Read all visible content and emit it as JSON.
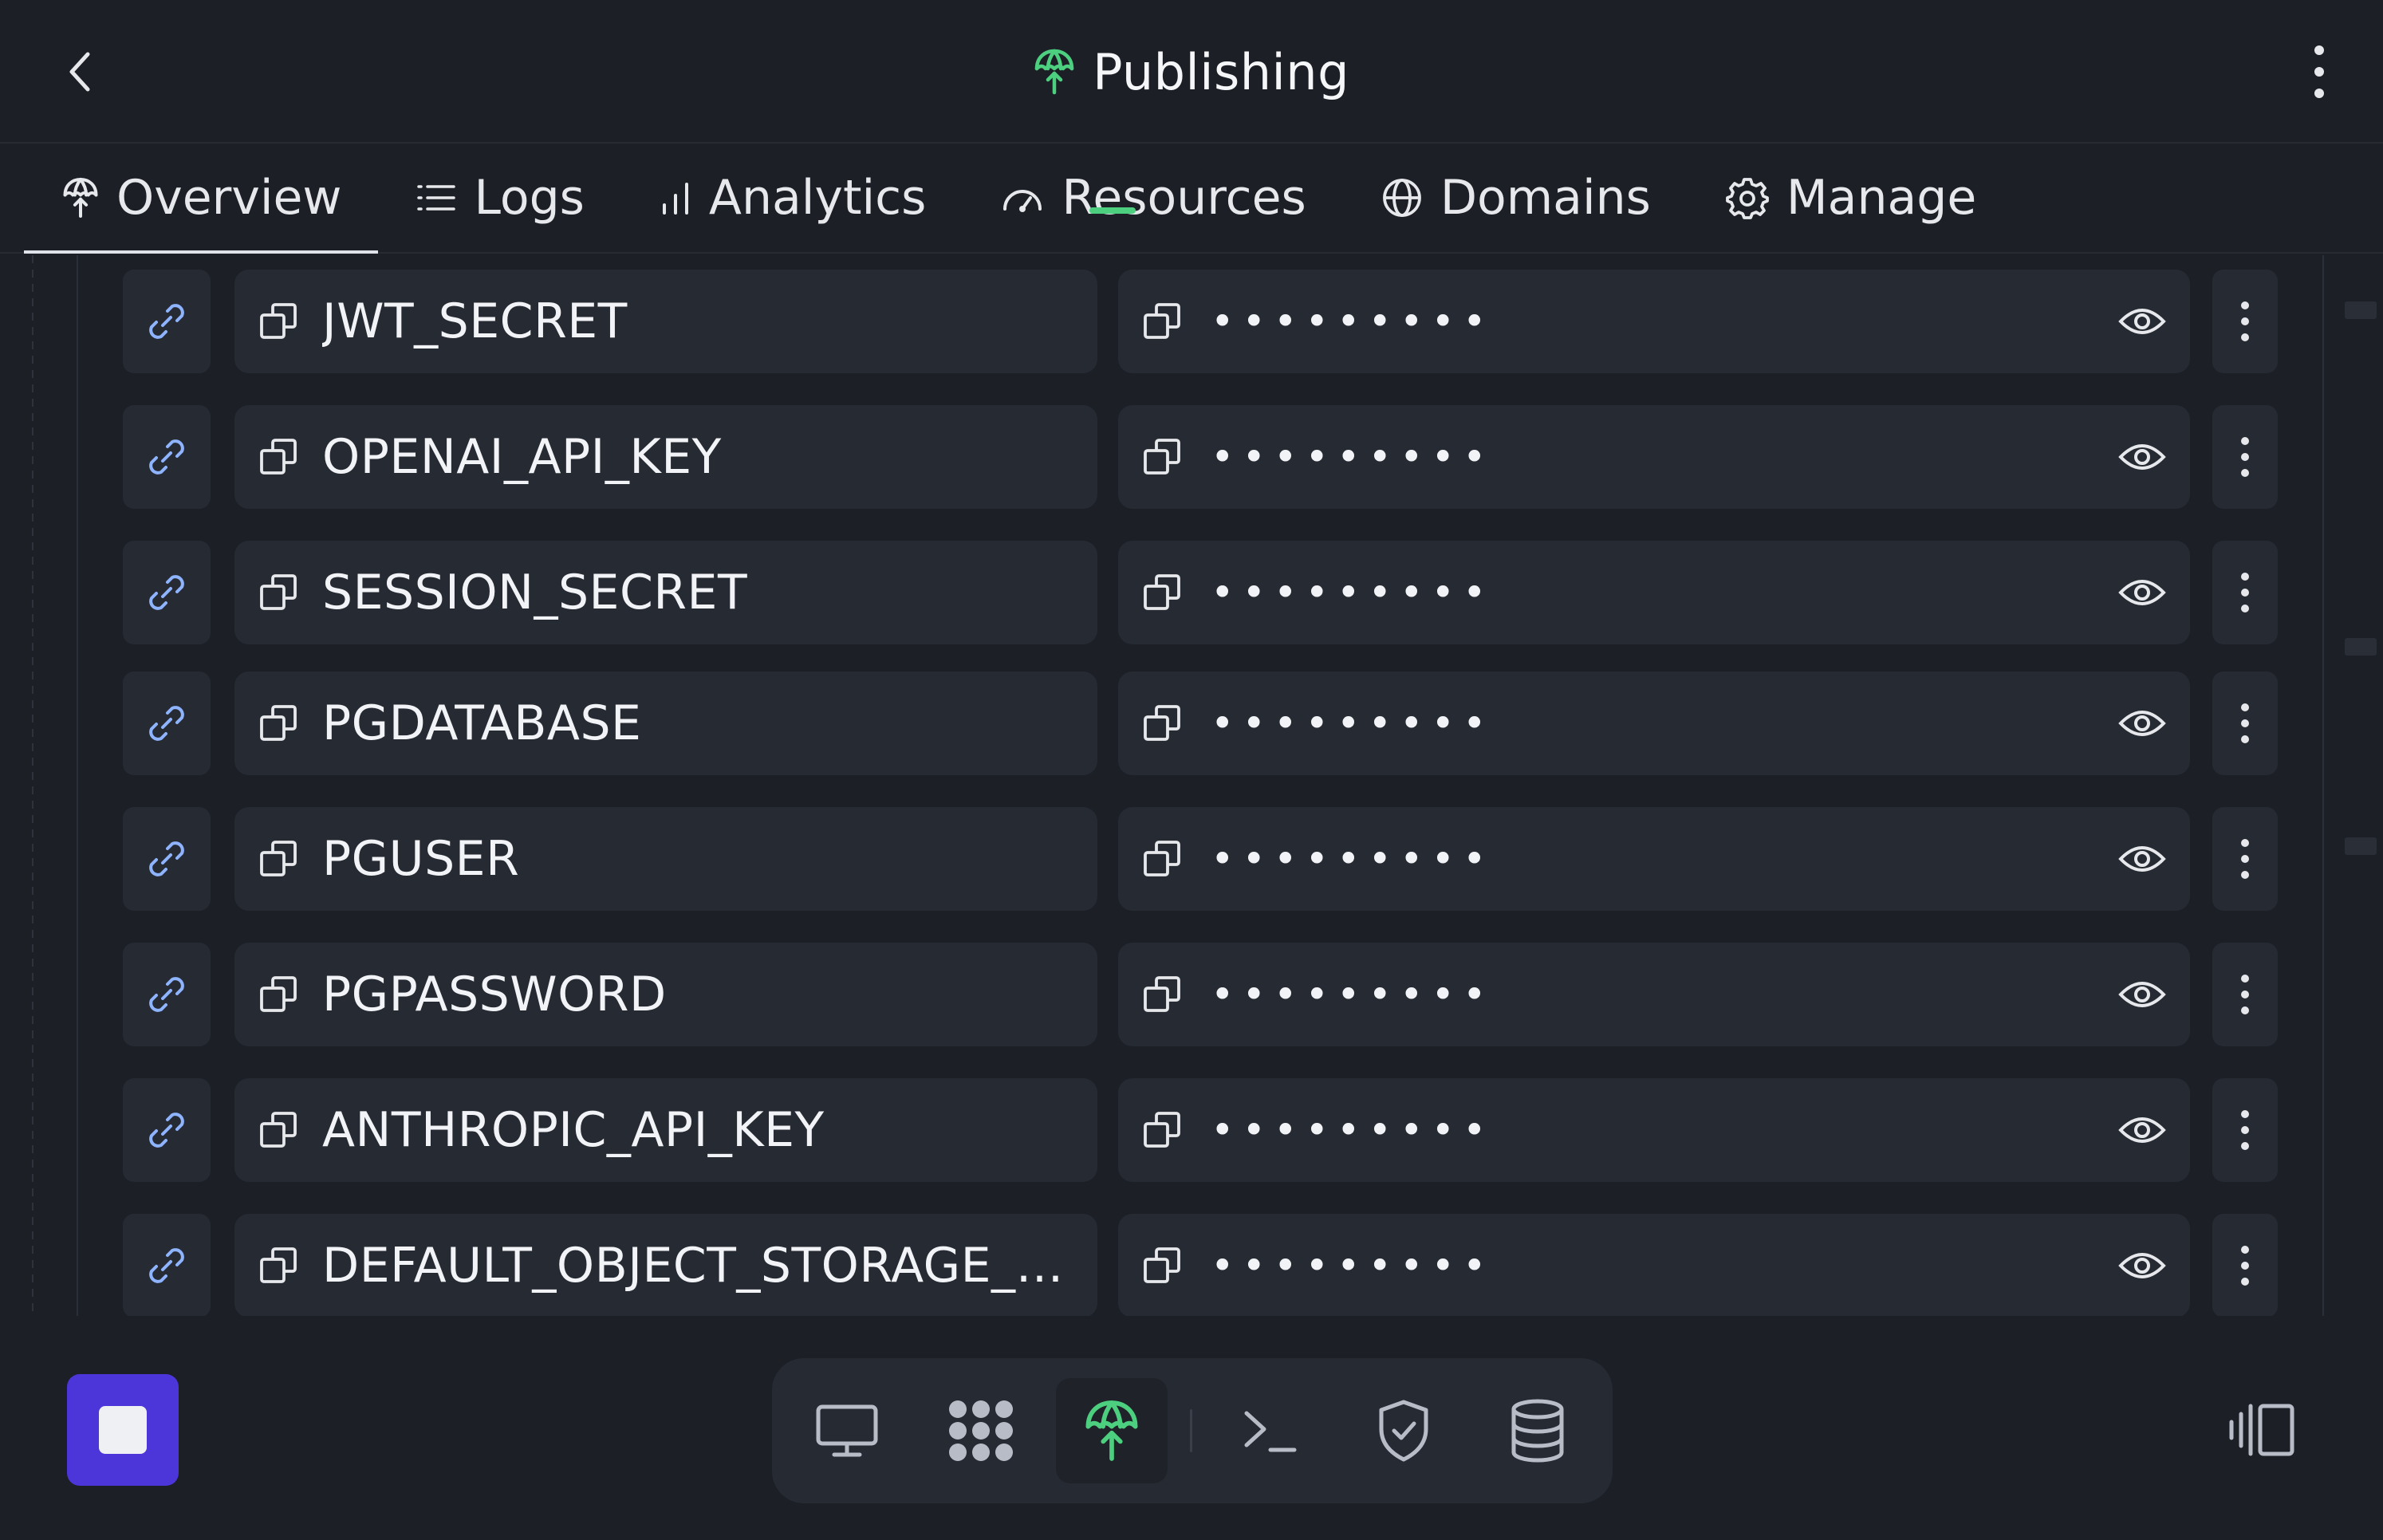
{
  "header": {
    "title": "Publishing",
    "accent": "#4cd080"
  },
  "tabs": [
    {
      "label": "Overview",
      "icon": "publish-icon",
      "active": true
    },
    {
      "label": "Logs",
      "icon": "list-icon"
    },
    {
      "label": "Analytics",
      "icon": "bar-chart-icon"
    },
    {
      "label": "Resources",
      "icon": "gauge-icon"
    },
    {
      "label": "Domains",
      "icon": "globe-icon"
    },
    {
      "label": "Manage",
      "icon": "gear-icon"
    }
  ],
  "secrets": [
    {
      "key": "JWT_SECRET",
      "value": "•••••••••"
    },
    {
      "key": "OPENAI_API_KEY",
      "value": "•••••••••"
    },
    {
      "key": "SESSION_SECRET",
      "value": "•••••••••"
    },
    {
      "key": "PGDATABASE",
      "value": "•••••••••"
    },
    {
      "key": "PGUSER",
      "value": "•••••••••"
    },
    {
      "key": "PGPASSWORD",
      "value": "•••••••••"
    },
    {
      "key": "ANTHROPIC_API_KEY",
      "value": "•••••••••"
    },
    {
      "key": "DEFAULT_OBJECT_STORAGE_B...",
      "value": "•••••••••"
    }
  ],
  "dock": {
    "items": [
      "monitor-icon",
      "workflows-icon",
      "publish-icon",
      "terminal-icon",
      "shield-icon",
      "database-icon"
    ],
    "active": "publish-icon"
  },
  "colors": {
    "background": "#1c1f26",
    "surface": "#262a33",
    "stop_button": "#4c35d9",
    "link_icon": "#8fb4ff"
  }
}
